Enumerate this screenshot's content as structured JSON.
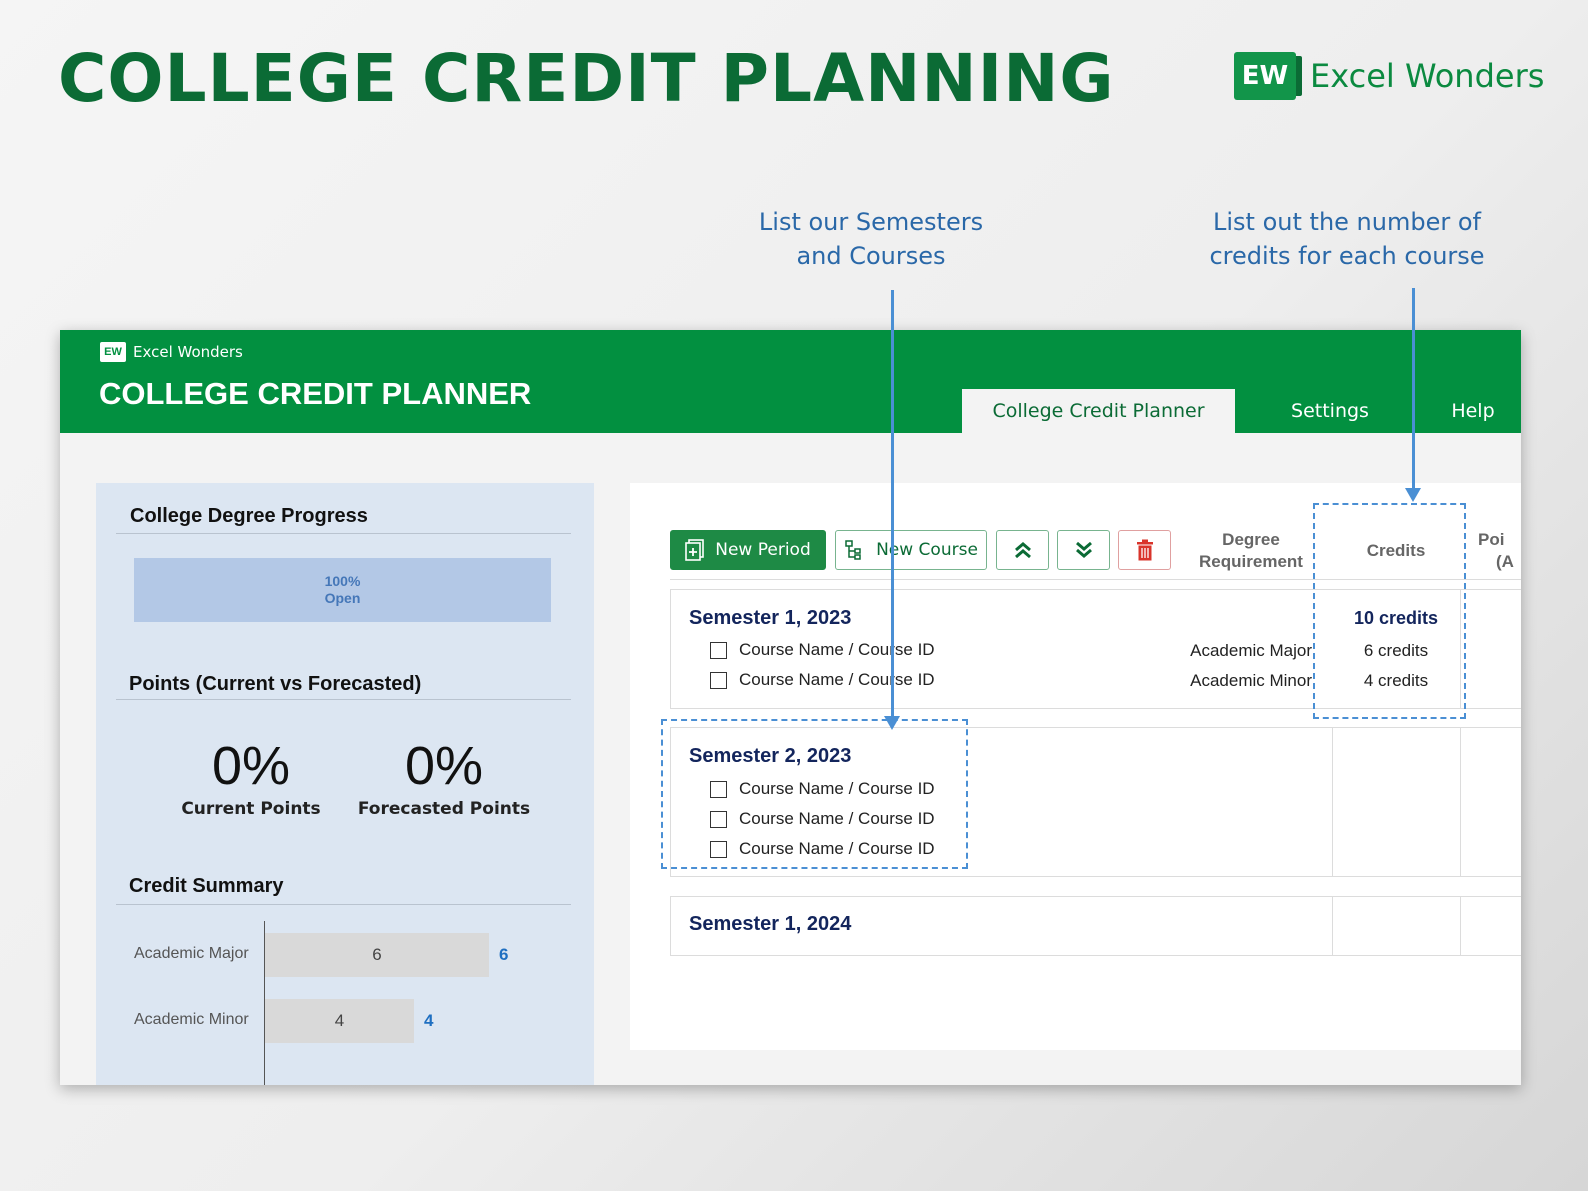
{
  "page": {
    "title": "COLLEGE CREDIT PLANNING",
    "brand_logo": "EW",
    "brand_name": "Excel Wonders",
    "annotation_semesters": "List our Semesters\nand Courses",
    "annotation_credits": "List out the number of\ncredits for each course"
  },
  "app": {
    "logo": "EW",
    "logo_text": "Excel Wonders",
    "title": "COLLEGE CREDIT PLANNER",
    "tabs": [
      "College Credit Planner",
      "Settings",
      "Help"
    ]
  },
  "left": {
    "progress_title": "College Degree Progress",
    "progress_pct": "100%",
    "progress_label": "Open",
    "progress_fraction": 1.0,
    "points_title": "Points (Current vs Forecasted)",
    "current_value": "0%",
    "current_label": "Current Points",
    "forecast_value": "0%",
    "forecast_label": "Forecasted Points",
    "credit_title": "Credit Summary",
    "bars": [
      {
        "label": "Academic Major",
        "value": "6",
        "total": "6",
        "amount": 6
      },
      {
        "label": "Academic Minor",
        "value": "4",
        "total": "4",
        "amount": 4
      }
    ]
  },
  "toolbar": {
    "new_period": "New Period",
    "new_course": "New Course"
  },
  "columns": {
    "degree_req_line1": "Degree",
    "degree_req_line2": "Requirement",
    "credits": "Credits",
    "points_line1": "Poi",
    "points_line2": "(A"
  },
  "semesters": [
    {
      "title": "Semester 1, 2023",
      "total": "10 credits",
      "courses": [
        {
          "name": "Course Name / Course ID",
          "req": "Academic Major",
          "credits": "6 credits"
        },
        {
          "name": "Course Name / Course ID",
          "req": "Academic Minor",
          "credits": "4 credits"
        }
      ]
    },
    {
      "title": "Semester 2, 2023",
      "courses": [
        {
          "name": "Course Name / Course ID"
        },
        {
          "name": "Course Name / Course ID"
        },
        {
          "name": "Course Name / Course ID"
        }
      ]
    },
    {
      "title": "Semester 1, 2024",
      "courses": []
    }
  ],
  "colors": {
    "brand_green": "#029040",
    "title_green": "#0b6b35",
    "annotation_blue": "#4a8fd4",
    "panel_blue": "#dce6f2",
    "semester_navy": "#13255c"
  }
}
